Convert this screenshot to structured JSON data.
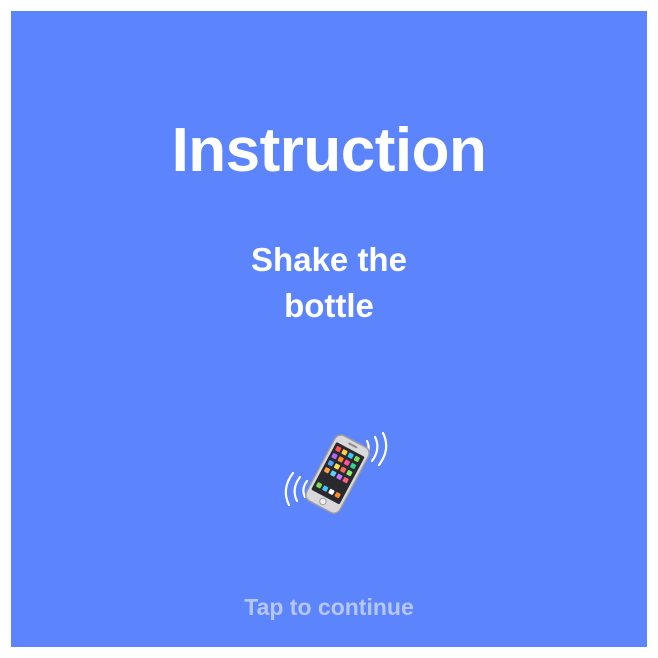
{
  "screen": {
    "background_color": "#5b84fd",
    "title": "Instruction",
    "instruction_text": "Shake the bottle",
    "illustration_icon": "vibrating-phone-icon",
    "tap_hint": "Tap to continue"
  }
}
